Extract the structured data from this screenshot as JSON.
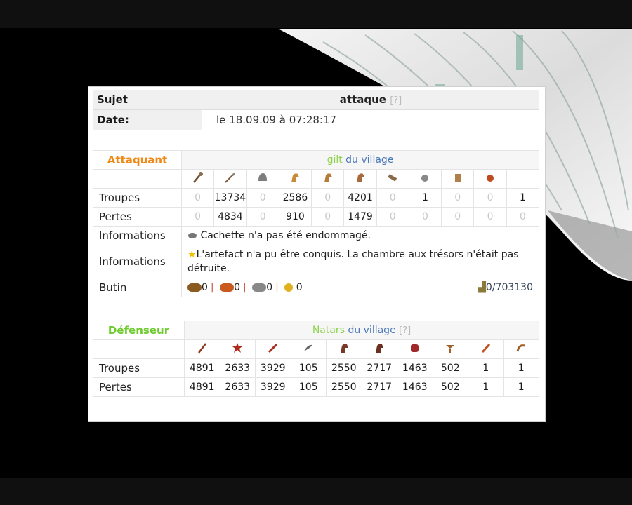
{
  "header": {
    "subject_label": "Sujet",
    "subject_value": "attaque",
    "subject_help": "[?]",
    "date_label": "Date:",
    "date_value": "le 18.09.09 à 07:28:17"
  },
  "attacker": {
    "role": "Attaquant",
    "player": "gilt",
    "village_text": "du village",
    "unit_icons": [
      "club-icon",
      "spear-icon",
      "helmet-icon",
      "horse-icon",
      "horse-icon",
      "horse-icon",
      "ram-icon",
      "catapult-icon",
      "chief-icon",
      "settler-icon",
      "hero-icon"
    ],
    "troops_label": "Troupes",
    "troops": [
      "0",
      "13734",
      "0",
      "2586",
      "0",
      "4201",
      "0",
      "1",
      "0",
      "0",
      "1"
    ],
    "losses_label": "Pertes",
    "losses": [
      "0",
      "4834",
      "0",
      "910",
      "0",
      "1479",
      "0",
      "0",
      "0",
      "0",
      "0"
    ],
    "info1_label": "Informations",
    "info1_text": "Cachette n'a pas été endommagé.",
    "info2_label": "Informations",
    "info2_text": "L'artefact n'a pu être conquis. La chambre aux trésors n'était pas détruite.",
    "bounty_label": "Butin",
    "bounty": [
      "0",
      "0",
      "0",
      "0"
    ],
    "carry": "0/703130"
  },
  "defender": {
    "role": "Défenseur",
    "player": "Natars",
    "village_text": "du village",
    "help": "[?]",
    "unit_icons": [
      "pikeman-icon",
      "thorned-warrior-icon",
      "guardsman-icon",
      "bird-icon",
      "horse-icon",
      "horse-icon",
      "elephant-icon",
      "ballista-icon",
      "prince-icon",
      "settler-icon"
    ],
    "troops_label": "Troupes",
    "troops": [
      "4891",
      "2633",
      "3929",
      "105",
      "2550",
      "2717",
      "1463",
      "502",
      "1",
      "1"
    ],
    "losses_label": "Pertes",
    "losses": [
      "4891",
      "2633",
      "3929",
      "105",
      "2550",
      "2717",
      "1463",
      "502",
      "1",
      "1"
    ]
  },
  "colors": {
    "attacker_role": "#f08a17",
    "defender_role": "#6ecb2d",
    "village_link": "#4a78b8"
  }
}
